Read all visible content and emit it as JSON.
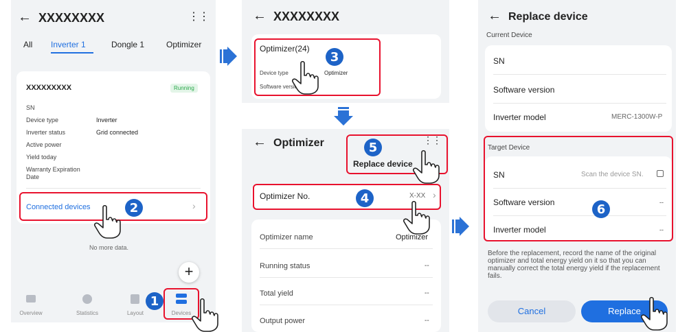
{
  "panel1": {
    "title": "XXXXXXXX",
    "tabs": [
      "All",
      "Inverter 1",
      "Dongle 1",
      "Optimizer"
    ],
    "device_name": "XXXXXXXXX",
    "status_badge": "Running",
    "fields": [
      {
        "label": "SN",
        "value": ""
      },
      {
        "label": "Device type",
        "value": "Inverter"
      },
      {
        "label": "Inverter status",
        "value": "Grid connected"
      },
      {
        "label": "Active power",
        "value": ""
      },
      {
        "label": "Yield today",
        "value": ""
      },
      {
        "label": "Warranty Expiration Date",
        "value": ""
      }
    ],
    "connected_devices": "Connected devices",
    "no_more": "No more data.",
    "nav": [
      "Overview",
      "Statistics",
      "Layout",
      "Devices"
    ]
  },
  "panel2a": {
    "title": "XXXXXXXX",
    "optimizer_count": "Optimizer(24)",
    "device_type_label": "Device type",
    "device_type_value": "Optimizer",
    "software_label": "Software version"
  },
  "panel2b": {
    "title": "Optimizer",
    "replace_device": "Replace device",
    "optimizer_no_label": "Optimizer No.",
    "optimizer_no_value": "X-XX",
    "rows": [
      {
        "label": "Optimizer name",
        "value": "Optimizer"
      },
      {
        "label": "Running status",
        "value": "--"
      },
      {
        "label": "Total yield",
        "value": "--"
      },
      {
        "label": "Output power",
        "value": "--"
      }
    ]
  },
  "panel3": {
    "title": "Replace device",
    "current_header": "Current Device",
    "current_rows": [
      {
        "label": "SN",
        "value": ""
      },
      {
        "label": "Software version",
        "value": ""
      },
      {
        "label": "Inverter model",
        "value": "MERC-1300W-P"
      }
    ],
    "target_header": "Target Device",
    "target_rows": [
      {
        "label": "SN",
        "value": "Scan the device SN."
      },
      {
        "label": "Software version",
        "value": "--"
      },
      {
        "label": "Inverter model",
        "value": "--"
      }
    ],
    "note": "Before the replacement, record the name of the original optimizer and total energy yield on it so that you can manually correct the total energy yield if the replacement fails.",
    "cancel": "Cancel",
    "replace": "Replace"
  },
  "steps": [
    "1",
    "2",
    "3",
    "4",
    "5",
    "6"
  ],
  "colors": {
    "accent": "#1f6fe0",
    "highlight": "#e8112d",
    "step_badge": "#1d63c7"
  }
}
